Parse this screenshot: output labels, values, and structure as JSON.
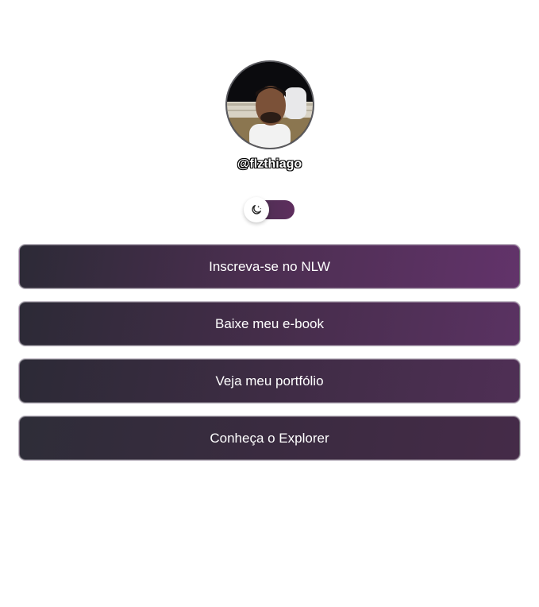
{
  "profile": {
    "avatar_alt": "Foto de perfil de @flzthiago",
    "username": "@flzthiago"
  },
  "theme_switch": {
    "icon": "moon-icon",
    "state": "dark"
  },
  "links": [
    {
      "label": "Inscreva-se no NLW"
    },
    {
      "label": "Baixe meu e-book"
    },
    {
      "label": "Veja meu portfólio"
    },
    {
      "label": "Conheça o Explorer"
    }
  ],
  "colors": {
    "accent": "#5e2d5e",
    "button_dark": "#2c2a36",
    "button_purple": "#62336a"
  }
}
